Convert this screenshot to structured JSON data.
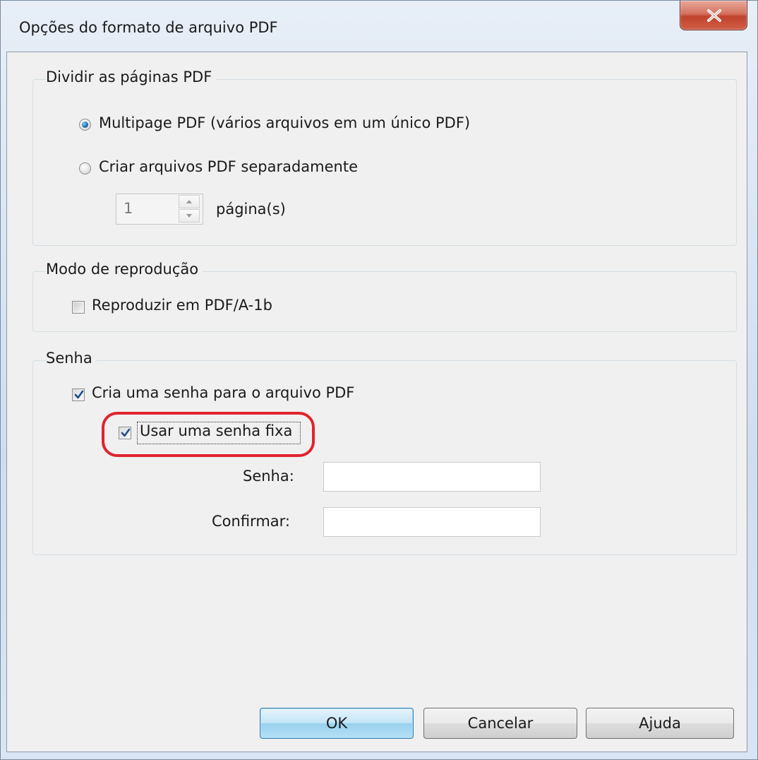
{
  "window": {
    "title": "Opções do formato de arquivo PDF"
  },
  "split_group": {
    "legend": "Dividir as páginas PDF",
    "option_multipage": "Multipage PDF (vários arquivos em um único PDF)",
    "option_separate": "Criar arquivos PDF separadamente",
    "pages_value": "1",
    "pages_unit": "página(s)",
    "selected": "option_multipage"
  },
  "reproduction_group": {
    "legend": "Modo de reprodução",
    "pdfa_label": "Reproduzir em PDF/A-1b",
    "pdfa_checked": false
  },
  "password_group": {
    "legend": "Senha",
    "create_password_label": "Cria uma senha para o arquivo PDF",
    "create_password_checked": true,
    "fixed_password_label": "Usar uma senha fixa",
    "fixed_password_checked": true,
    "password_label": "Senha:",
    "password_value": "",
    "confirm_label": "Confirmar:",
    "confirm_value": ""
  },
  "buttons": {
    "ok": "OK",
    "cancel": "Cancelar",
    "help": "Ajuda"
  },
  "colors": {
    "highlight": "#e0232e",
    "radio_selected": "#1e6fae",
    "close_button": "#c0422b"
  }
}
